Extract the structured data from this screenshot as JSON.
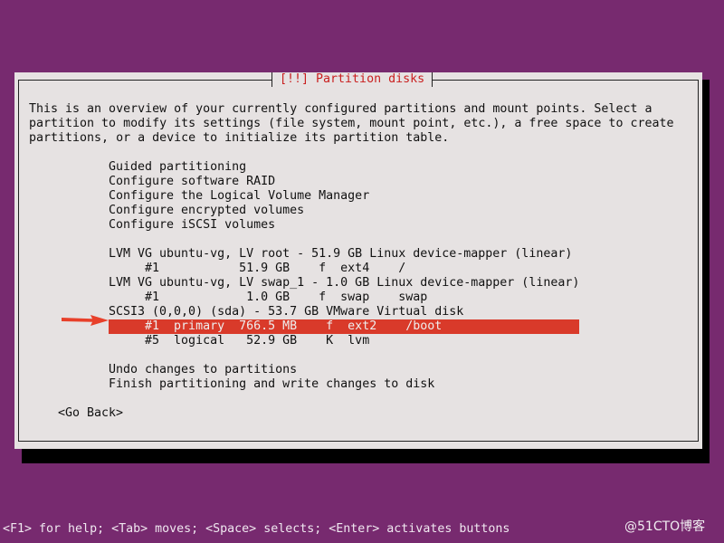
{
  "dialog": {
    "title": "[!!] Partition disks",
    "intro": [
      "This is an overview of your currently configured partitions and mount points. Select a",
      "partition to modify its settings (file system, mount point, etc.), a free space to create",
      "partitions, or a device to initialize its partition table."
    ],
    "menu": [
      "Guided partitioning",
      "Configure software RAID",
      "Configure the Logical Volume Manager",
      "Configure encrypted volumes",
      "Configure iSCSI volumes"
    ],
    "devices": [
      "LVM VG ubuntu-vg, LV root - 51.9 GB Linux device-mapper (linear)",
      "     #1           51.9 GB    f  ext4    /",
      "LVM VG ubuntu-vg, LV swap_1 - 1.0 GB Linux device-mapper (linear)",
      "     #1            1.0 GB    f  swap    swap",
      "SCSI3 (0,0,0) (sda) - 53.7 GB VMware Virtual disk",
      "     #1  primary  766.5 MB    f  ext2    /boot",
      "     #5  logical   52.9 GB    K  lvm"
    ],
    "selected_index": 5,
    "undo": "Undo changes to partitions",
    "finish": "Finish partitioning and write changes to disk",
    "go_back": "<Go Back>"
  },
  "footer": "<F1> for help; <Tab> moves; <Space> selects; <Enter> activates buttons",
  "watermark": "@51CTO博客",
  "colors": {
    "background": "#772a6f",
    "dialog": "#e6e2e2",
    "selection": "#d93a2a",
    "title": "#c91f1f",
    "arrow": "#e8402a"
  }
}
